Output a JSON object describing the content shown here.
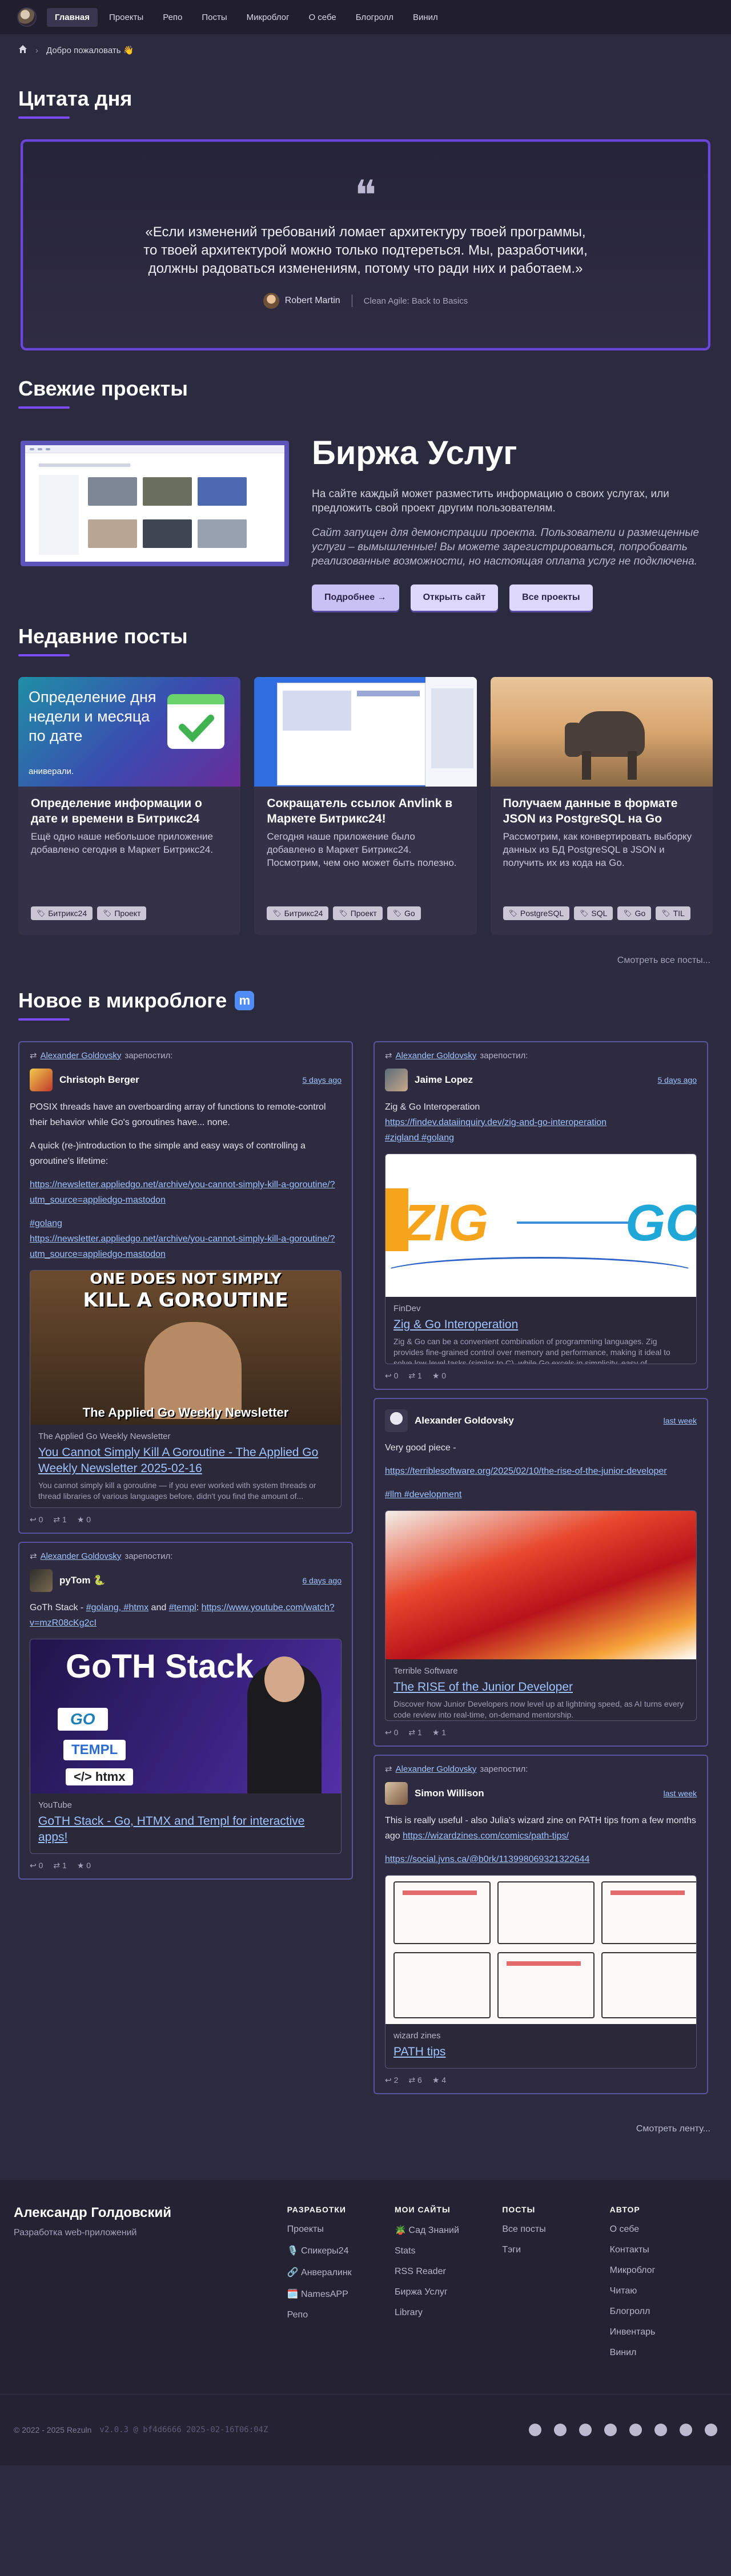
{
  "nav": {
    "items": [
      "Главная",
      "Проекты",
      "Репо",
      "Посты",
      "Микроблог",
      "О себе",
      "Блогролл",
      "Винил"
    ],
    "active": 0
  },
  "breadcrumb": {
    "label": "Добро пожаловать 👋"
  },
  "quote": {
    "section_title": "Цитата дня",
    "text": "«Если изменений требований ломает архитектуру твоей программы, то твоей архитектурой можно только подтереться. Мы, разработчики, должны радоваться изменениям, потому что ради них и работаем.»",
    "author": "Robert Martin",
    "book": "Clean Agile: Back to Basics"
  },
  "projects": {
    "section_title": "Свежие проекты",
    "title": "Биржа Услуг",
    "description": "На сайте каждый может разместить информацию о своих услугах, или предложить свой проект другим пользователям.",
    "note": "Сайт запущен для демонстрации проекта. Пользователи и размещенные услуги – вымышленные! Вы можете зарегистрироваться, попробовать реализованные возможности, но настоящая оплата услуг не подключена.",
    "btn_more": "Подробнее →",
    "btn_open": "Открыть сайт",
    "btn_all": "Все проекты"
  },
  "posts": {
    "section_title": "Недавние посты",
    "items": [
      {
        "title": "Определение информации о дате и времени в Битрикс24",
        "text": "Ещё одно наше небольшое приложение добавлено сегодня в Маркет Битрикс24.",
        "tags": [
          "Битрикс24",
          "Проект"
        ],
        "img_text": "Определение дня недели и месяца по дате",
        "img_brand": "аниверали."
      },
      {
        "title": "Сокращатель ссылок Anvlink в Маркете Битрикс24!",
        "text": "Сегодня наше приложение было добавлено в Маркет Битрикс24. Посмотрим, чем оно может быть полезно.",
        "tags": [
          "Битрикс24",
          "Проект",
          "Go"
        ]
      },
      {
        "title": "Получаем данные в формате JSON из PostgreSQL на Go",
        "text": "Рассмотрим, как конвертировать выборку данных из БД PostgreSQL в JSON и получить их из кода на Go.",
        "tags": [
          "PostgreSQL",
          "SQL",
          "Go",
          "TIL"
        ]
      }
    ],
    "all_label": "Смотреть все посты..."
  },
  "microblog": {
    "section_title": "Новое в микроблоге",
    "boost_text": "зарепостил:",
    "boost_user": "Alexander Goldovsky",
    "col1": [
      {
        "boosted": true,
        "name": "Christoph Berger",
        "date": "5 days ago",
        "paragraphs": [
          "POSIX threads have an overboarding array of functions to remote-control their behavior while Go's goroutines have... none.",
          "A quick (re-)introduction to the simple and easy ways of controlling a goroutine's lifetime:"
        ],
        "link1": "https://newsletter.appliedgo.net/archive/you-cannot-simply-kill-a-goroutine/?utm_source=appliedgo-mastodon",
        "hashtag": "#golang",
        "link2": "https://newsletter.appliedgo.net/archive/you-cannot-simply-kill-a-goroutine/?utm_source=appliedgo-mastodon",
        "card": {
          "img_top": "ONE DOES NOT SIMPLY",
          "img_mid": "KILL A GOROUTINE",
          "img_bottom": "The Applied Go Weekly Newsletter",
          "source": "The Applied Go Weekly Newsletter",
          "title": "You Cannot Simply Kill A Goroutine - The Applied Go Weekly Newsletter 2025-02-16",
          "desc": "You cannot simply kill a goroutine — if you ever worked with system threads or thread libraries of various languages before, didn't you find the amount of..."
        },
        "stats": {
          "replies": "0",
          "boosts": "1",
          "favs": "0"
        }
      },
      {
        "boosted": true,
        "name": "pyTom 🐍",
        "date": "6 days ago",
        "text_pre": "GoTh Stack - ",
        "tags": "#golang, #htmx",
        "text_and": " and ",
        "tag3": "#templ",
        "text_colon": ": ",
        "link": "https://www.youtube.com/watch?v=mzR08cKg2cI",
        "card": {
          "img_title": "GoTH Stack",
          "img_go": "GO",
          "img_templ": "TEMPL",
          "img_htmx": "</> htmx",
          "source": "YouTube",
          "title": "GoTH Stack - Go, HTMX and Templ for interactive apps!",
          "desc": ""
        },
        "stats": {
          "replies": "0",
          "boosts": "1",
          "favs": "0"
        }
      }
    ],
    "col2": [
      {
        "boosted": true,
        "name": "Jaime Lopez",
        "date": "5 days ago",
        "line1": "Zig & Go Interoperation",
        "link": "https://findev.dataiinquiry.dev/zig-and-go-interoperation",
        "tags": "#zigland #golang",
        "card": {
          "img_zig": "ZIG",
          "img_go": "GO",
          "source": "FinDev",
          "title": "Zig & Go Interoperation",
          "desc": "Zig & Go can be a convenient combination of programming languages. Zig provides fine-grained control over memory and performance, making it ideal to solve low-level tasks (similar to C), while Go excels in simplicity, easy of development, and built-i..."
        },
        "stats": {
          "replies": "0",
          "boosts": "1",
          "favs": "0"
        }
      },
      {
        "boosted": false,
        "name": "Alexander Goldovsky",
        "date": "last week",
        "line1": "Very good piece -",
        "link": "https://terriblesoftware.org/2025/02/10/the-rise-of-the-junior-developer",
        "tags": "#llm #development",
        "card": {
          "source": "Terrible Software",
          "title": "The RISE of the Junior Developer",
          "desc": "Discover how Junior Developers now level up at lightning speed, as AI turns every code review into real-time, on-demand mentorship."
        },
        "stats": {
          "replies": "0",
          "boosts": "1",
          "favs": "1"
        }
      },
      {
        "boosted": true,
        "name": "Simon Willison",
        "date": "last week",
        "line1": "This is really useful - also Julia's wizard zine on PATH tips from a few months ago ",
        "link_a": "https://wizardzines.com/comics/path-tips/",
        "link_b": "https://social.jvns.ca/@b0rk/113998069321322644",
        "card": {
          "source": "wizard zines",
          "title": "PATH tips",
          "desc": ""
        },
        "stats": {
          "replies": "2",
          "boosts": "6",
          "favs": "4"
        }
      }
    ],
    "see_more": "Смотреть ленту..."
  },
  "footer": {
    "name": "Александр Голдовский",
    "role": "Разработка web-приложений",
    "cols": [
      {
        "head": "РАЗРАБОТКИ",
        "items": [
          "Проекты",
          "🎙️ Спикеры24",
          "🔗 Анвералинк",
          "🗓️ NamesAPP",
          "Репо"
        ]
      },
      {
        "head": "МОИ САЙТЫ",
        "items": [
          "🪴 Сад Знаний",
          "Stats",
          "RSS Reader",
          "Биржа Услуг",
          "Library"
        ]
      },
      {
        "head": "ПОСТЫ",
        "items": [
          "Все посты",
          "Тэги"
        ]
      },
      {
        "head": "АВТОР",
        "items": [
          "О себе",
          "Контакты",
          "Микроблог",
          "Читаю",
          "Блогролл",
          "Инвентарь",
          "Винил"
        ]
      }
    ],
    "copyright": "© 2022 - 2025 Rezuln",
    "build": "v2.0.3 @ bf4d6666 2025-02-16T06:04Z",
    "social_icons": [
      "telegram-icon",
      "mail-icon",
      "github-icon",
      "gitlab-icon",
      "mastodon-icon",
      "bluesky-icon",
      "vk-icon",
      "steam-icon"
    ]
  },
  "colors": {
    "bg": "#2c2a3e",
    "accent": "#7b4dff",
    "link": "#9ec3ff"
  }
}
